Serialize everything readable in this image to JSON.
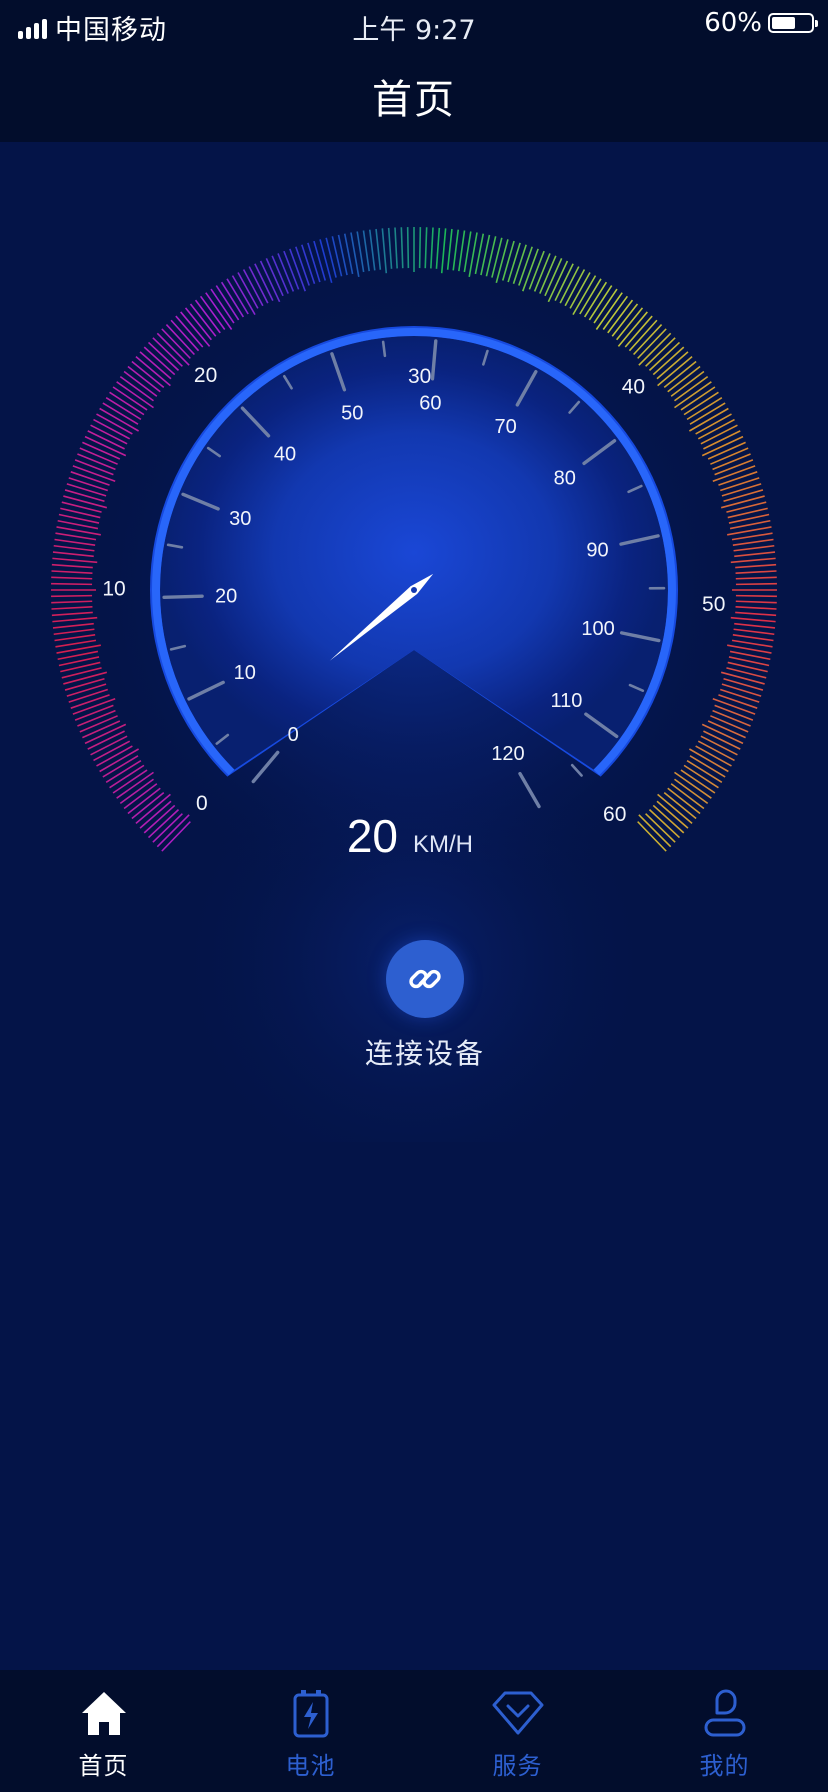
{
  "status_bar": {
    "carrier": "中国移动",
    "time": "上午 9:27",
    "battery": "60%",
    "battery_level": 0.6
  },
  "header": {
    "title": "首页"
  },
  "gauge": {
    "outer_labels": [
      "0",
      "10",
      "20",
      "30",
      "40",
      "50",
      "60"
    ],
    "inner_labels": [
      "0",
      "10",
      "20",
      "30",
      "40",
      "50",
      "60",
      "70",
      "80",
      "90",
      "100",
      "110",
      "120"
    ],
    "speed_value": "20",
    "speed_unit": "KM/H",
    "needle_value": 20,
    "colors": {
      "accent": "#1a4fe0",
      "needle": "#ffffff",
      "rainbow": [
        "#cc1f9e",
        "#e0204f",
        "#b11fd6",
        "#1f3fd8",
        "#1fbf5a",
        "#c6d23a",
        "#e3902c",
        "#e9304a",
        "#d7c72e"
      ]
    }
  },
  "connect": {
    "label": "连接设备",
    "icon": "link-icon"
  },
  "tabs": [
    {
      "label": "首页",
      "icon": "home-icon",
      "active": true
    },
    {
      "label": "电池",
      "icon": "battery-icon",
      "active": false
    },
    {
      "label": "服务",
      "icon": "diamond-icon",
      "active": false
    },
    {
      "label": "我的",
      "icon": "user-icon",
      "active": false
    }
  ]
}
